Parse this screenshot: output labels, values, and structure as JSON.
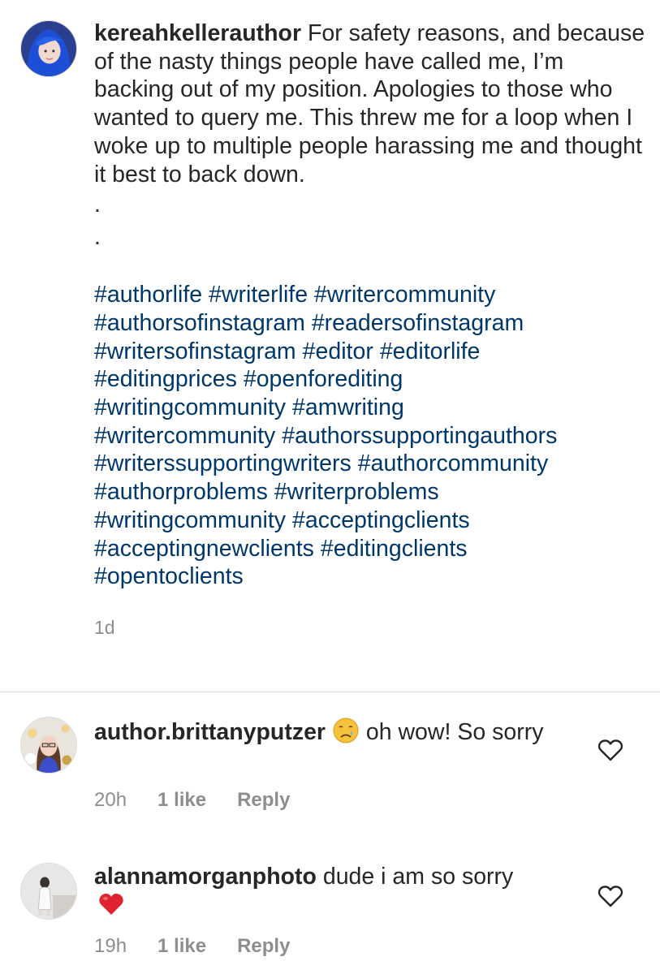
{
  "post": {
    "username": "kereahkellerauthor",
    "caption": "For safety reasons, and because of the nasty things people have called me, I’m backing out of my position. Apologies to those who wanted to query me. This threw me for a loop when I woke up to multiple people harassing me and thought it best to back down.",
    "dots": [
      ".",
      "."
    ],
    "hashtags": [
      "#authorlife",
      "#writerlife",
      "#writercommunity",
      "#authorsofinstagram",
      "#readersofinstagram",
      "#writersofinstagram",
      "#editor",
      "#editorlife",
      "#editingprices",
      "#openforediting",
      "#writingcommunity",
      "#amwriting",
      "#writercommunity",
      "#authorssupportingauthors",
      "#writerssupportingwriters",
      "#authorcommunity",
      "#authorproblems",
      "#writerproblems",
      "#writingcommunity",
      "#acceptingclients",
      "#acceptingnewclients",
      "#editingclients",
      "#opentoclients"
    ],
    "time": "1d"
  },
  "comments": [
    {
      "username": "author.brittanyputzer",
      "emoji_icon": "crying-face-icon",
      "text": "oh wow! So sorry",
      "time": "20h",
      "likes": "1 like",
      "reply": "Reply"
    },
    {
      "username": "alannamorganphoto",
      "text": "dude i am so sorry",
      "emoji_icon": "red-heart-icon",
      "time": "19h",
      "likes": "1 like",
      "reply": "Reply"
    }
  ],
  "colors": {
    "text": "#262626",
    "hashtag": "#00376b",
    "secondary": "#8e8e8e",
    "divider": "#dbdbdb"
  }
}
